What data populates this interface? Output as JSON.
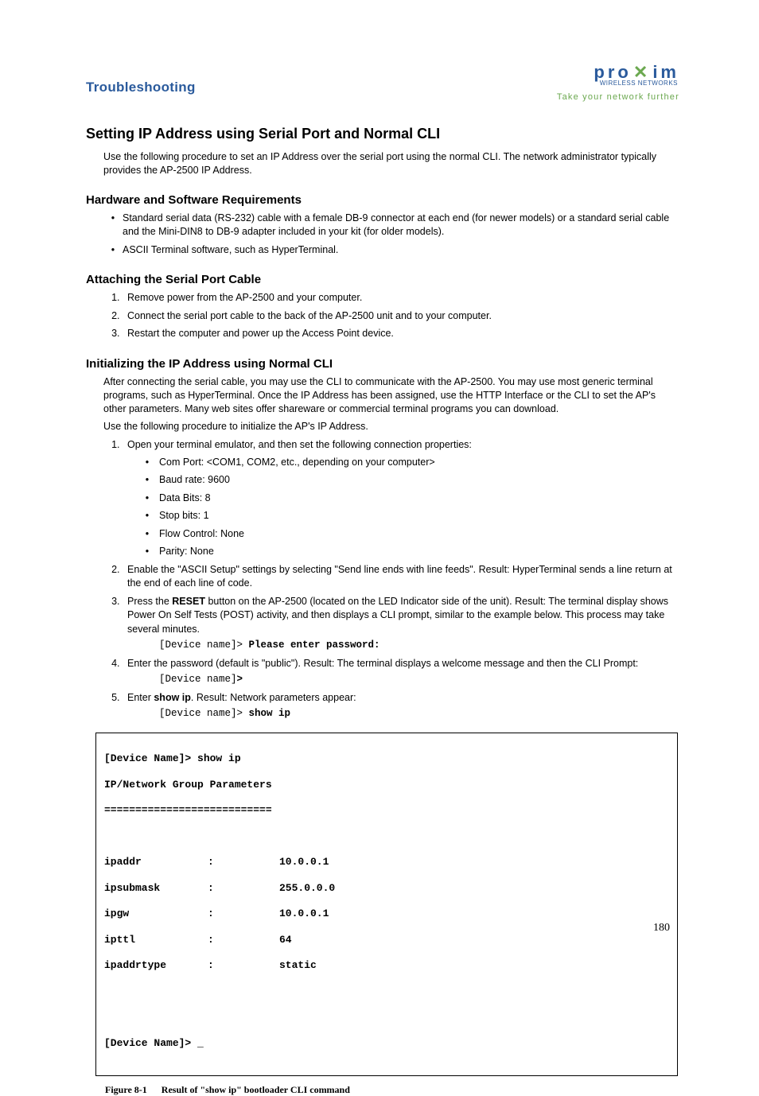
{
  "brand": {
    "name": "proxim",
    "subline": "WIRELESS NETWORKS",
    "tagline": "Take your network further"
  },
  "chapter": "Troubleshooting",
  "h1": "Setting IP Address using Serial Port and Normal CLI",
  "intro": "Use the following procedure to set an IP Address over the serial port using the normal CLI. The network administrator typically provides the AP-2500 IP Address.",
  "sec_hw": {
    "title": "Hardware and Software Requirements",
    "items": [
      "Standard serial data (RS-232) cable with a female DB-9 connector at each end (for newer models) or a standard serial cable and the Mini-DIN8 to DB-9 adapter included in your kit (for older models).",
      "ASCII Terminal software, such as HyperTerminal."
    ]
  },
  "sec_attach": {
    "title": "Attaching the Serial Port Cable",
    "items": [
      "Remove power from the AP-2500 and your computer.",
      "Connect the serial port cable to the back of the AP-2500 unit and to your computer.",
      "Restart the computer and power up the Access Point device."
    ]
  },
  "sec_init": {
    "title": "Initializing the IP Address using Normal CLI",
    "para1": "After connecting the serial cable, you may use the CLI to communicate with the AP-2500. You may use most generic terminal programs, such as HyperTerminal. Once the IP Address has been assigned, use the HTTP Interface or the CLI to set the AP's other parameters. Many web sites offer shareware or commercial terminal programs you can download.",
    "para2": "Use the following procedure to initialize the AP's IP Address.",
    "step1": "Open your terminal emulator, and then set the following connection properties:",
    "step1_sub": [
      "Com Port: <COM1, COM2, etc., depending on your computer>",
      "Baud rate: 9600",
      "Data Bits: 8",
      "Stop bits: 1",
      "Flow Control: None",
      "Parity: None"
    ],
    "step2": "Enable the \"ASCII Setup\" settings by selecting \"Send line ends with line feeds\". Result: HyperTerminal sends a line return at the end of each line of code.",
    "step3_a": "Press the ",
    "step3_reset": "RESET",
    "step3_b": " button on the AP-2500 (located on the LED Indicator side of the unit). Result: The terminal display shows Power On Self Tests (POST) activity, and then displays a CLI prompt, similar to the example below. This process may take several minutes.",
    "step3_code_a": "[Device name]> ",
    "step3_code_b": "Please enter password:",
    "step4": "Enter the password (default is \"public\"). Result: The terminal displays a welcome message and then the CLI Prompt:",
    "step4_code_a": "[Device name]",
    "step4_code_b": ">",
    "step5_a": "Enter ",
    "step5_cmd": "show ip",
    "step5_b": ". Result: Network parameters appear:",
    "step5_code_a": "[Device name]> ",
    "step5_code_b": "show ip"
  },
  "terminal": {
    "line1": "[Device Name]> show ip",
    "line2": "IP/Network Group Parameters",
    "line3": "===========================",
    "rows": [
      {
        "k": "ipaddr",
        "c": ":",
        "v": "10.0.0.1"
      },
      {
        "k": "ipsubmask",
        "c": ":",
        "v": "255.0.0.0"
      },
      {
        "k": "ipgw",
        "c": ":",
        "v": "10.0.0.1"
      },
      {
        "k": "ipttl",
        "c": ":",
        "v": "64"
      },
      {
        "k": "ipaddrtype",
        "c": ":",
        "v": "static"
      }
    ],
    "prompt": "[Device Name]> _"
  },
  "figure": {
    "num": "Figure 8-1",
    "caption": "Result of \"show ip\" bootloader CLI command"
  },
  "page": "180"
}
